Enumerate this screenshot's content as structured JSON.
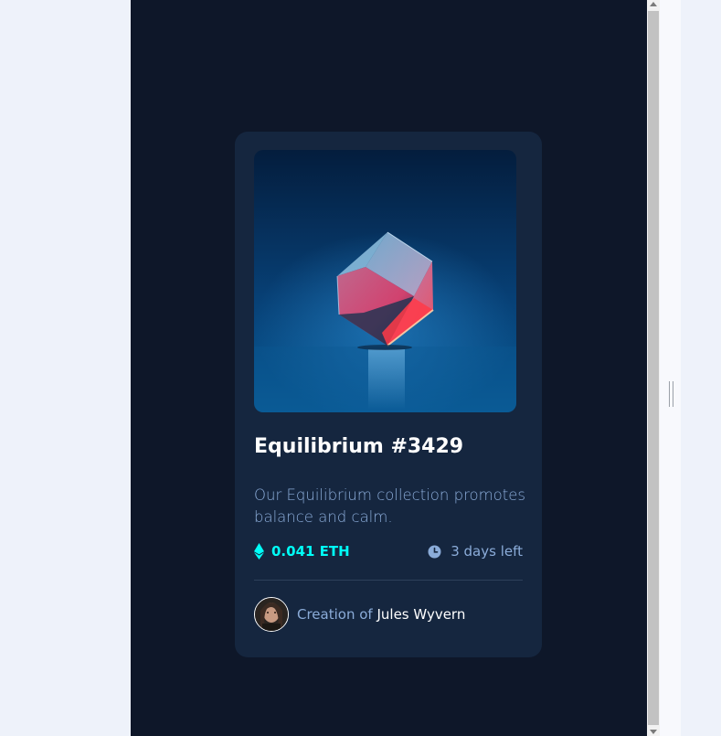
{
  "card": {
    "image_alt": "Equilibrium cube artwork",
    "title": "Equilibrium #3429",
    "description": "Our Equilibrium collection promotes balance and calm.",
    "price": "0.041 ETH",
    "time_left": "3 days left",
    "creator_prefix": "Creation of ",
    "creator_name": "Jules Wyvern"
  },
  "colors": {
    "page_bg": "#0e1729",
    "card_bg": "#15263f",
    "accent_cyan": "#00fff8",
    "soft_blue": "#8bacd9",
    "white": "#ffffff"
  },
  "icons": {
    "price_icon": "ethereum-icon",
    "time_icon": "clock-icon"
  }
}
